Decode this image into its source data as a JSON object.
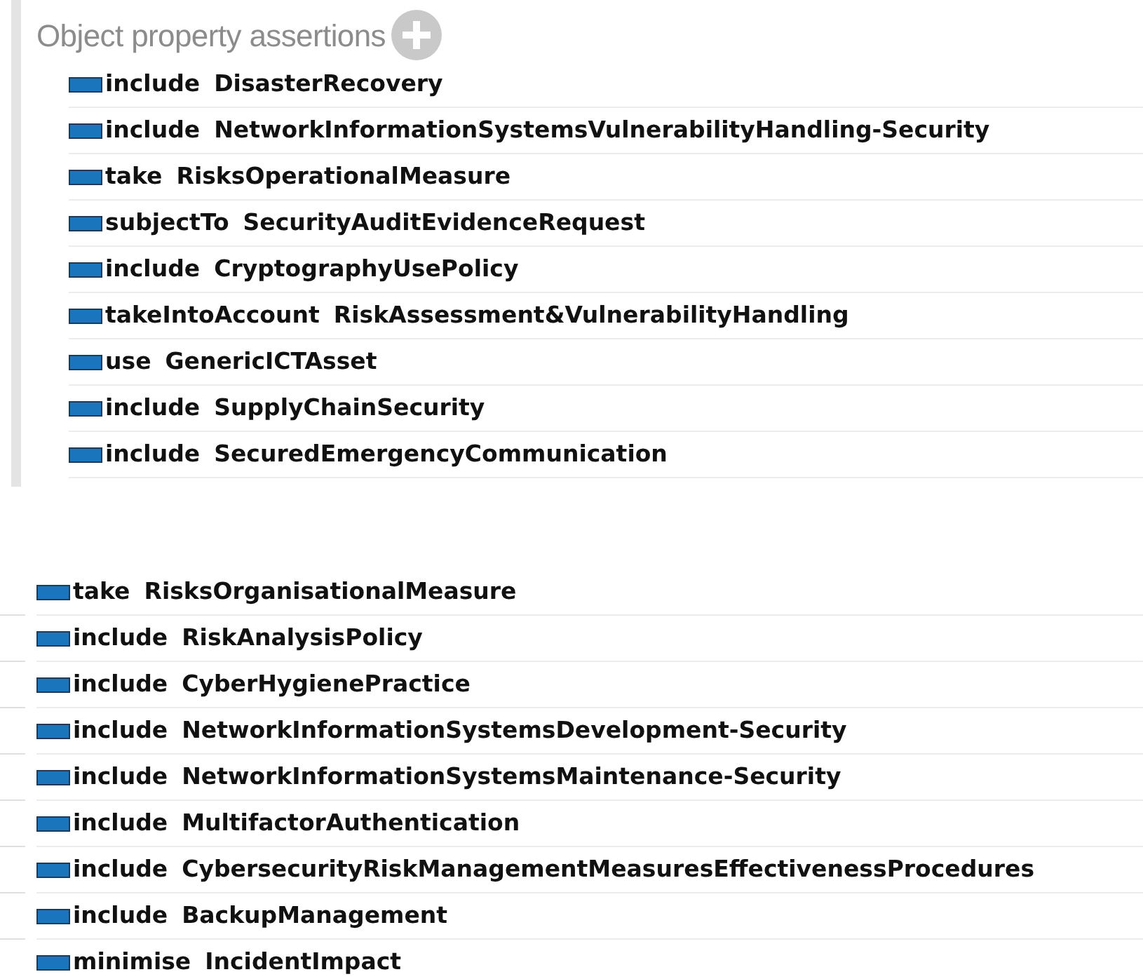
{
  "section": {
    "title": "Object property assertions",
    "assertions": [
      {
        "property": "include",
        "value": "DisasterRecovery"
      },
      {
        "property": "include",
        "value": "NetworkInformationSystemsVulnerabilityHandling-Security"
      },
      {
        "property": "take",
        "value": "RisksOperationalMeasure"
      },
      {
        "property": "subjectTo",
        "value": "SecurityAuditEvidenceRequest"
      },
      {
        "property": "include",
        "value": "CryptographyUsePolicy"
      },
      {
        "property": "takeIntoAccount",
        "value": "RiskAssessment&VulnerabilityHandling"
      },
      {
        "property": "use",
        "value": "GenericICTAsset"
      },
      {
        "property": "include",
        "value": "SupplyChainSecurity"
      },
      {
        "property": "include",
        "value": "SecuredEmergencyCommunication"
      }
    ]
  },
  "second_list": [
    {
      "property": "take",
      "value": "RisksOrganisationalMeasure"
    },
    {
      "property": "include",
      "value": "RiskAnalysisPolicy"
    },
    {
      "property": "include",
      "value": "CyberHygienePractice"
    },
    {
      "property": "include",
      "value": "NetworkInformationSystemsDevelopment-Security"
    },
    {
      "property": "include",
      "value": "NetworkInformationSystemsMaintenance-Security"
    },
    {
      "property": "include",
      "value": "MultifactorAuthentication"
    },
    {
      "property": "include",
      "value": "CybersecurityRiskManagementMeasuresEffectivenessProcedures"
    },
    {
      "property": "include",
      "value": "BackupManagement"
    },
    {
      "property": "minimise",
      "value": "IncidentImpact"
    }
  ]
}
